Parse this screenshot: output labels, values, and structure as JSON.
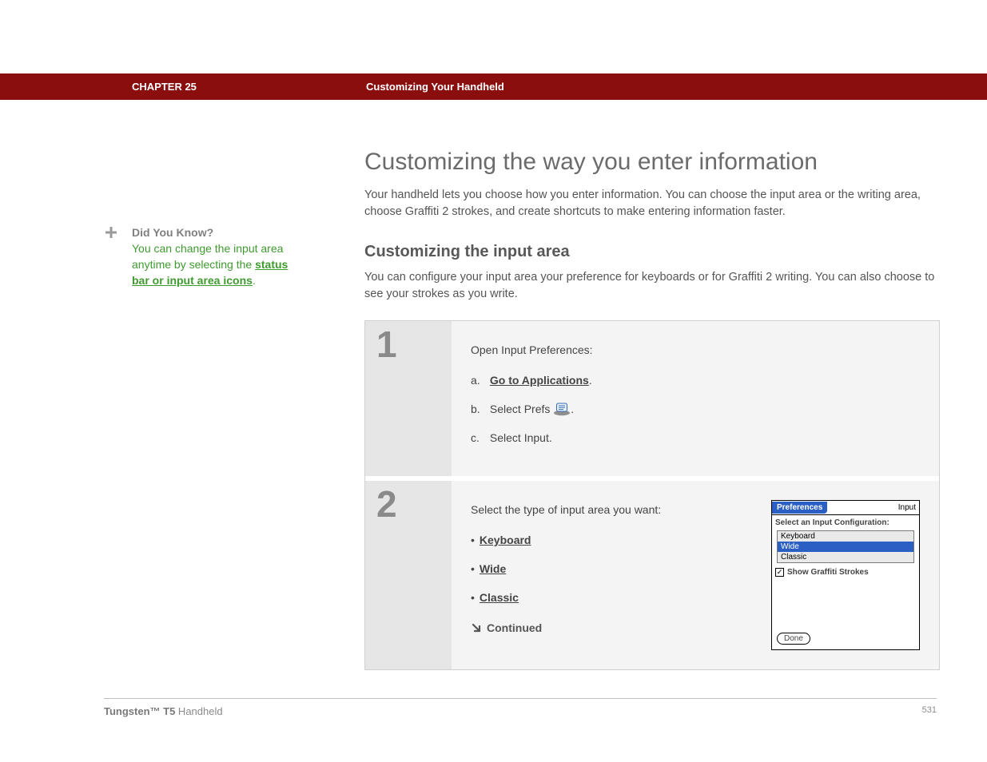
{
  "header": {
    "chapter": "CHAPTER 25",
    "title": "Customizing Your Handheld"
  },
  "sidebar": {
    "dyk_title": "Did You Know?",
    "dyk_pre": "You can change the input area anytime by selecting the ",
    "dyk_link": "status bar or input area icons",
    "dyk_post": "."
  },
  "main": {
    "h1": "Customizing the way you enter information",
    "intro": "Your handheld lets you choose how you enter information. You can choose the input area or the writing area, choose Graffiti 2 strokes, and create shortcuts to make entering information faster.",
    "h2": "Customizing the input area",
    "subintro": "You can configure your input area your preference for keyboards or for Graffiti 2 writing. You can also choose to see your strokes as you write."
  },
  "steps": {
    "s1": {
      "num": "1",
      "lead": "Open Input Preferences:",
      "a_label": "a.",
      "a_link": "Go to Applications",
      "a_post": ".",
      "b_label": "b.",
      "b_pre": "Select Prefs ",
      "b_post": ".",
      "c_label": "c.",
      "c_text": "Select Input."
    },
    "s2": {
      "num": "2",
      "lead": "Select the type of input area you want:",
      "opt1": "Keyboard",
      "opt2": "Wide",
      "opt3": "Classic",
      "continued": "Continued"
    }
  },
  "palm": {
    "title_left": "Preferences",
    "title_right": "Input",
    "label": "Select an Input Configuration:",
    "opt_keyboard": "Keyboard",
    "opt_wide": "Wide",
    "opt_classic": "Classic",
    "checkbox_label": "Show Graffiti Strokes",
    "done": "Done"
  },
  "footer": {
    "product_bold": "Tungsten™ T5",
    "product_rest": " Handheld",
    "page": "531"
  }
}
